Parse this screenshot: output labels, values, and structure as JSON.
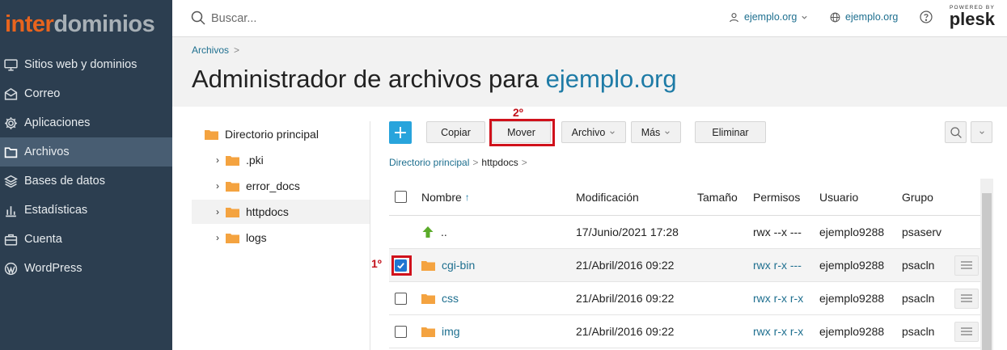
{
  "brand": {
    "logo_part1": "inter",
    "logo_part2": "dominios"
  },
  "sidebar": {
    "items": [
      {
        "label": "Sitios web y dominios",
        "icon": "monitor-icon"
      },
      {
        "label": "Correo",
        "icon": "mail-icon"
      },
      {
        "label": "Aplicaciones",
        "icon": "gear-icon"
      },
      {
        "label": "Archivos",
        "icon": "folder-icon",
        "active": true
      },
      {
        "label": "Bases de datos",
        "icon": "database-icon"
      },
      {
        "label": "Estadísticas",
        "icon": "bar-chart-icon"
      },
      {
        "label": "Cuenta",
        "icon": "briefcase-icon"
      },
      {
        "label": "WordPress",
        "icon": "wordpress-icon"
      }
    ]
  },
  "topbar": {
    "search_placeholder": "Buscar...",
    "account_label": "ejemplo.org",
    "domain_label": "ejemplo.org",
    "powered_by": "POWERED BY",
    "plesk": "plesk"
  },
  "header": {
    "breadcrumb": "Archivos",
    "title_prefix": "Administrador de archivos para",
    "title_domain": "ejemplo.org"
  },
  "tree": {
    "root": "Directorio principal",
    "children": [
      ".pki",
      "error_docs",
      "httpdocs",
      "logs"
    ],
    "selected": "httpdocs"
  },
  "toolbar": {
    "add_label": "+",
    "copy": "Copiar",
    "move": "Mover",
    "file": "Archivo",
    "more": "Más",
    "delete": "Eliminar"
  },
  "annotations": {
    "step1": "1º",
    "step2": "2º"
  },
  "path": {
    "root": "Directorio principal",
    "current": "httpdocs"
  },
  "table": {
    "columns": {
      "name": "Nombre",
      "modified": "Modificación",
      "size": "Tamaño",
      "perms": "Permisos",
      "user": "Usuario",
      "group": "Grupo"
    },
    "rows": [
      {
        "name": "..",
        "type": "up",
        "modified": "17/Junio/2021 17:28",
        "perms": "rwx --x ---",
        "user": "ejemplo9288",
        "group": "psaserv"
      },
      {
        "name": "cgi-bin",
        "type": "folder",
        "modified": "21/Abril/2016 09:22",
        "perms": "rwx r-x ---",
        "user": "ejemplo9288",
        "group": "psacln",
        "checked": true
      },
      {
        "name": "css",
        "type": "folder",
        "modified": "21/Abril/2016 09:22",
        "perms": "rwx r-x r-x",
        "user": "ejemplo9288",
        "group": "psacln"
      },
      {
        "name": "img",
        "type": "folder",
        "modified": "21/Abril/2016 09:22",
        "perms": "rwx r-x r-x",
        "user": "ejemplo9288",
        "group": "psacln"
      }
    ]
  },
  "colors": {
    "sidebar_bg": "#2c3e50",
    "accent": "#28a4dc",
    "link": "#1e6f8f",
    "highlight": "#d0111b"
  }
}
